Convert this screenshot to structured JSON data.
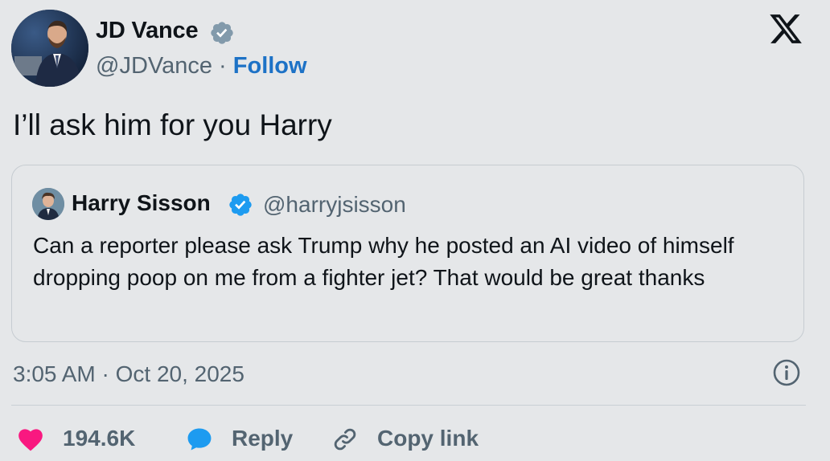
{
  "tweet": {
    "author": {
      "name": "JD Vance",
      "handle": "@JDVance",
      "separator": "·",
      "follow_label": "Follow"
    },
    "text": "I’ll ask him for you Harry",
    "quoted": {
      "name": "Harry Sisson",
      "handle": "@harryjsisson",
      "text": "Can a reporter please ask Trump why he posted an AI video of himself dropping poop on me from a fighter jet? That would be great thanks"
    },
    "timestamp": "3:05 AM · Oct 20, 2025",
    "actions": {
      "likes": "194.6K",
      "reply_label": "Reply",
      "copy_link_label": "Copy link"
    }
  },
  "icons": {
    "brand": "x-logo",
    "verified": "verified-badge-icon",
    "info": "info-icon",
    "like": "heart-icon",
    "reply": "speech-bubble-icon",
    "copy": "link-icon"
  },
  "colors": {
    "background": "#e5e7e9",
    "follow": "#1d72c6",
    "verified_main": "#829aab",
    "verified_quote": "#1d9bf0",
    "heart": "#f91880",
    "reply_bubble": "#1d9bf0",
    "muted_text": "#536471"
  }
}
